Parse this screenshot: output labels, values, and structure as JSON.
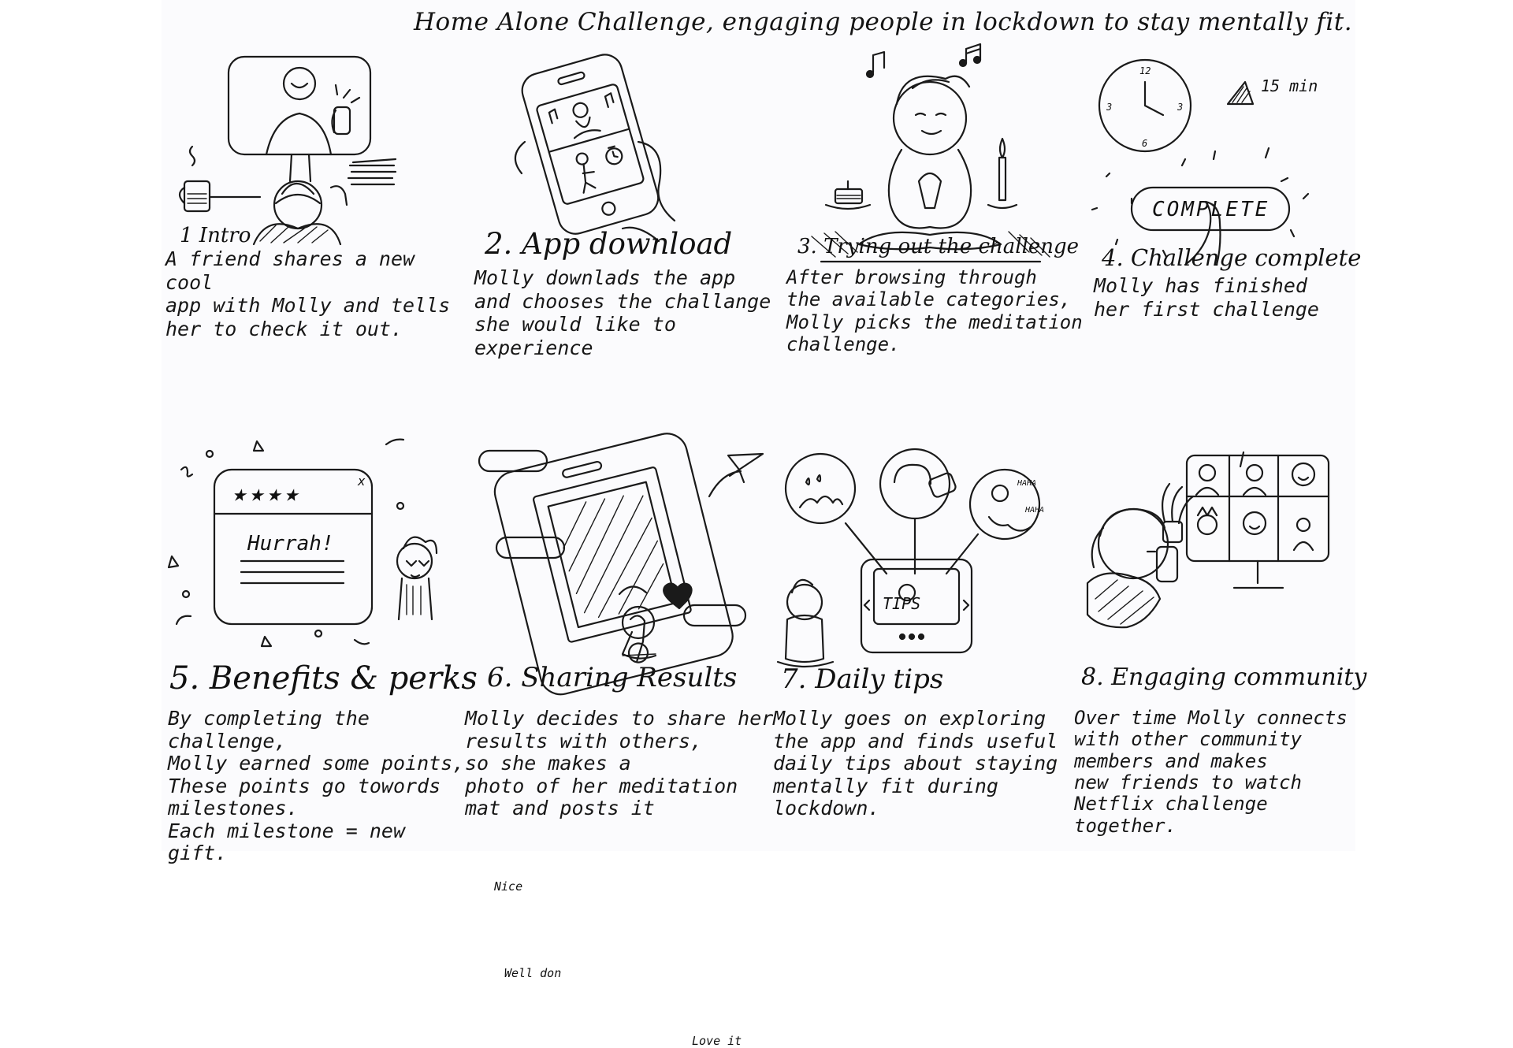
{
  "title": "Home Alone Challenge, engaging people in lockdown to stay mentally fit.",
  "panels": [
    {
      "heading": "1 Intro",
      "text": "A friend shares a new cool\napp with Molly and tells\nher to check it out."
    },
    {
      "heading": "2. App download",
      "text": "Molly downlads the app\nand chooses the challange\nshe would like to\nexperience"
    },
    {
      "heading": "3. Trying out the challenge",
      "text": "After browsing through\nthe available categories,\nMolly picks the meditation\nchallenge."
    },
    {
      "heading": "4. Challenge complete",
      "text": "Molly has finished\nher first challenge",
      "clock_labels": [
        "12",
        "3",
        "3",
        "6"
      ],
      "timer_label": "15 min",
      "button_label": "COMPLETE"
    },
    {
      "heading": "5. Benefits & perks",
      "text": "By completing the challenge,\nMolly earned some points,\nThese points go towords\nmilestones.\nEach milestone = new gift.",
      "stars": "★★★★",
      "popup_label": "Hurrah!",
      "close_label": "x"
    },
    {
      "heading": "6. Sharing Results",
      "text": "Molly decides to share her\nresults with others,\nso she makes a\nphoto of her meditation\nmat and posts it",
      "bubbles": [
        "Nice",
        "Well don",
        "Love it"
      ]
    },
    {
      "heading": "7. Daily tips",
      "text": "Molly goes on exploring\nthe app and finds useful\ndaily tips about staying\nmentally fit during\nlockdown.",
      "tips_label": "TIPS",
      "laugh_labels": [
        "HAHA",
        "HAHA"
      ]
    },
    {
      "heading": "8. Engaging community",
      "text": "Over time Molly connects\nwith other community\nmembers and makes\nnew friends to watch\nNetflix challenge together."
    }
  ]
}
